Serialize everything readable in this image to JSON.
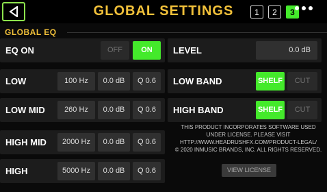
{
  "header": {
    "title": "GLOBAL SETTINGS",
    "pages": [
      "1",
      "2",
      "3"
    ],
    "active_page": "3"
  },
  "section_title": "GLOBAL EQ",
  "left": {
    "eq_on": {
      "label": "EQ ON",
      "off": "OFF",
      "on": "ON",
      "state": "ON"
    },
    "low": {
      "label": "LOW",
      "freq": "100 Hz",
      "gain": "0.0 dB",
      "q": "Q 0.6"
    },
    "low_mid": {
      "label": "LOW MID",
      "freq": "260 Hz",
      "gain": "0.0 dB",
      "q": "Q 0.6"
    },
    "high_mid": {
      "label": "HIGH MID",
      "freq": "2000 Hz",
      "gain": "0.0 dB",
      "q": "Q 0.6"
    },
    "high": {
      "label": "HIGH",
      "freq": "5000 Hz",
      "gain": "0.0 dB",
      "q": "Q 0.6"
    }
  },
  "right": {
    "level": {
      "label": "LEVEL",
      "value": "0.0 dB"
    },
    "low_band": {
      "label": "LOW BAND",
      "shelf": "SHELF",
      "cut": "CUT",
      "selected": "SHELF"
    },
    "high_band": {
      "label": "HIGH BAND",
      "shelf": "SHELF",
      "cut": "CUT",
      "selected": "SHELF"
    },
    "notice_lines": [
      "THIS PRODUCT INCORPORATES SOFTWARE USED",
      "UNDER LICENSE. PLEASE VISIT",
      "HTTP://WWW.HEADRUSHFX.COM/PRODUCT-LEGAL/",
      "© 2020 INMUSIC BRANDS, INC. ALL RIGHTS RESERVED."
    ],
    "view_license": "VIEW LICENSE"
  },
  "colors": {
    "accent_yellow": "#f2c13a",
    "active_green": "#44ea2b",
    "back_border": "#8de34d"
  }
}
